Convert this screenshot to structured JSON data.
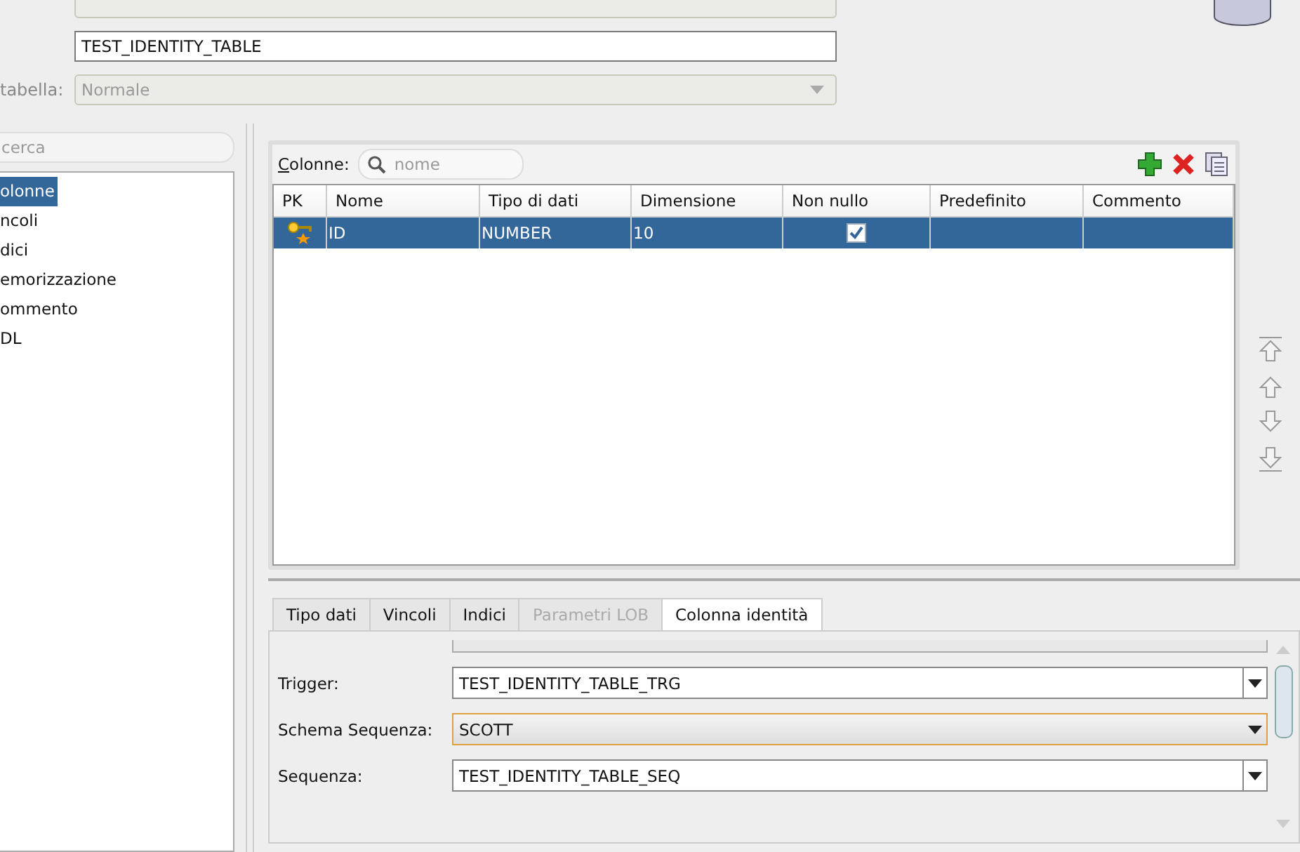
{
  "header": {
    "name_field": {
      "value": "TEST_IDENTITY_TABLE"
    },
    "type_field": {
      "label": "tabella:",
      "value": "Normale",
      "disabled": true
    }
  },
  "sidebar": {
    "search": {
      "placeholder": "cerca"
    },
    "items": [
      {
        "label": "olonne",
        "selected": true
      },
      {
        "label": "ncoli",
        "selected": false
      },
      {
        "label": "dici",
        "selected": false
      },
      {
        "label": "emorizzazione",
        "selected": false
      },
      {
        "label": "ommento",
        "selected": false
      },
      {
        "label": "DL",
        "selected": false
      }
    ]
  },
  "columns_table": {
    "label": "Colonne:",
    "search": {
      "placeholder": "nome"
    },
    "columns": [
      "PK",
      "Nome",
      "Tipo di dati",
      "Dimensione",
      "Non nullo",
      "Predefinito",
      "Commento"
    ],
    "rows": [
      {
        "pk": true,
        "name": "ID",
        "type": "NUMBER",
        "size": "10",
        "not_null": true,
        "default": "",
        "comment": "",
        "selected": true
      }
    ]
  },
  "detail_tabs": [
    {
      "label": "Tipo dati",
      "selected": false,
      "disabled": false
    },
    {
      "label": "Vincoli",
      "selected": false,
      "disabled": false
    },
    {
      "label": "Indici",
      "selected": false,
      "disabled": false
    },
    {
      "label": "Parametri LOB",
      "selected": false,
      "disabled": true
    },
    {
      "label": "Colonna identità",
      "selected": true,
      "disabled": false
    }
  ],
  "identity_fields": [
    {
      "label": "Trigger:",
      "value": "TEST_IDENTITY_TABLE_TRG",
      "focused": false
    },
    {
      "label": "Schema Sequenza:",
      "value": "SCOTT",
      "focused": true
    },
    {
      "label": "Sequenza:",
      "value": "TEST_IDENTITY_TABLE_SEQ",
      "focused": false
    }
  ]
}
